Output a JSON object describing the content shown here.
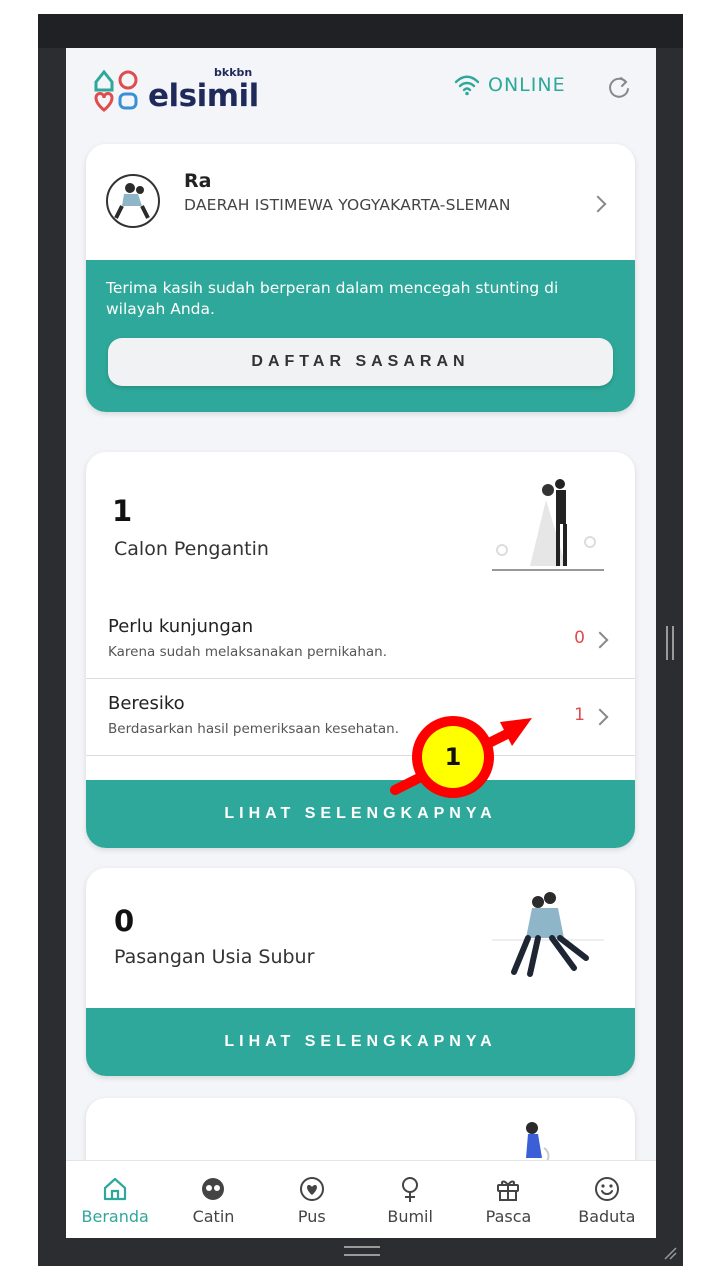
{
  "header": {
    "logo_text": "elsimil",
    "logo_sub": "bkkbn",
    "status": "ONLINE"
  },
  "profile": {
    "name": "Ra",
    "region": "DAERAH ISTIMEWA YOGYAKARTA-SLEMAN",
    "message": "Terima kasih sudah berperan dalam mencegah stunting di wilayah Anda.",
    "button": "DAFTAR SASARAN"
  },
  "catin": {
    "count": "1",
    "label": "Calon Pengantin",
    "rows": [
      {
        "title": "Perlu kunjungan",
        "subtitle": "Karena sudah melaksanakan pernikahan.",
        "count": "0"
      },
      {
        "title": "Beresiko",
        "subtitle": "Berdasarkan hasil pemeriksaan kesehatan.",
        "count": "1"
      }
    ],
    "button": "LIHAT SELENGKAPNYA"
  },
  "pus": {
    "count": "0",
    "label": "Pasangan Usia Subur",
    "button": "LIHAT SELENGKAPNYA"
  },
  "nav": [
    {
      "label": "Beranda",
      "icon": "home-icon"
    },
    {
      "label": "Catin",
      "icon": "couple-face-icon"
    },
    {
      "label": "Pus",
      "icon": "heart-icon"
    },
    {
      "label": "Bumil",
      "icon": "female-icon"
    },
    {
      "label": "Pasca",
      "icon": "gift-icon"
    },
    {
      "label": "Baduta",
      "icon": "smile-icon"
    }
  ],
  "annotation": {
    "marker": "1"
  },
  "colors": {
    "accent": "#2ea89a",
    "danger": "#e04b4b",
    "navy": "#1f2a5a"
  }
}
